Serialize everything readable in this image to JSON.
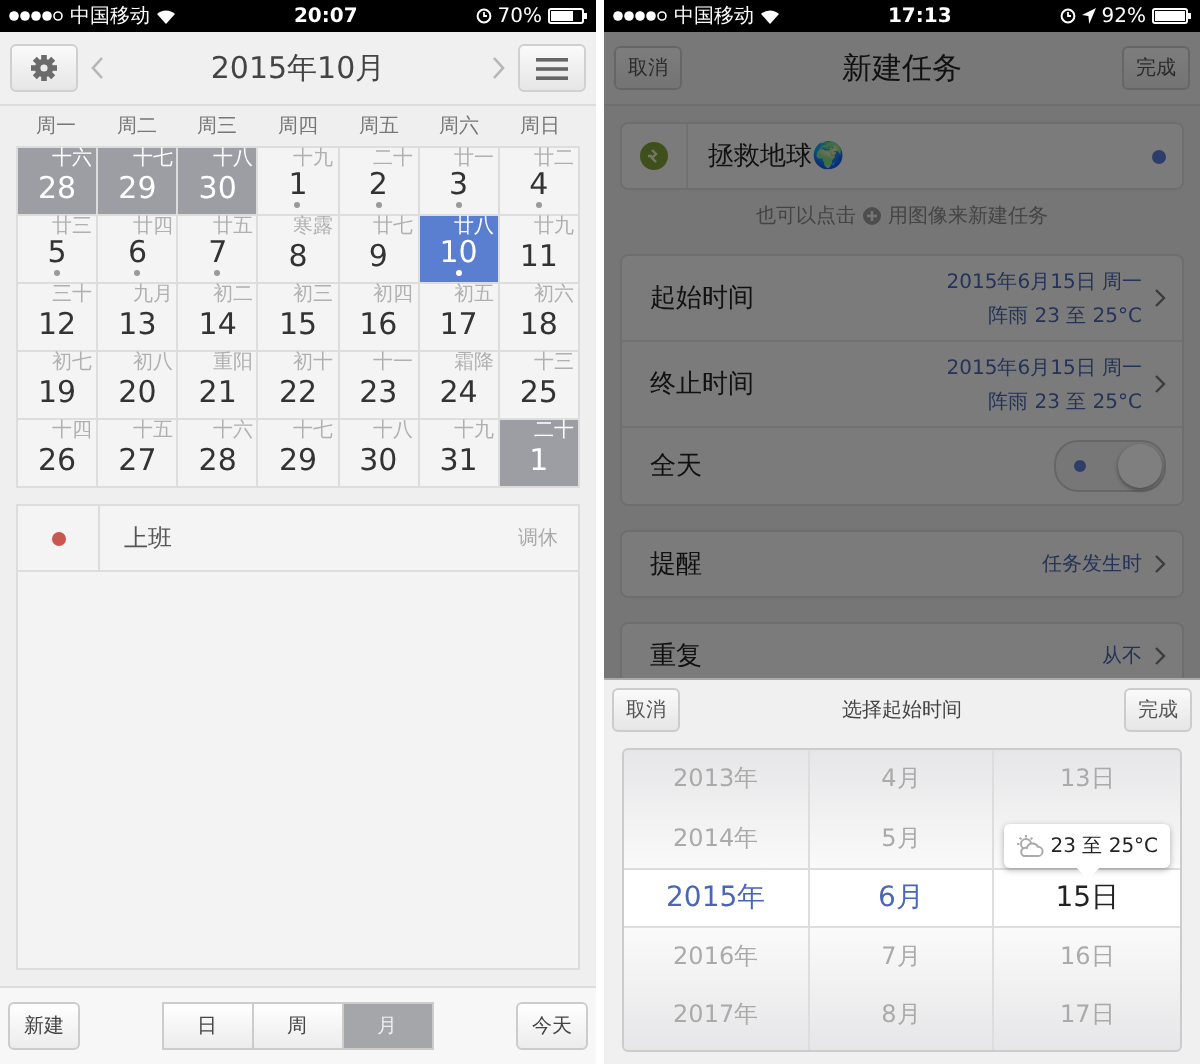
{
  "left": {
    "status_bar": {
      "carrier": "中国移动",
      "time": "20:07",
      "battery": "70%"
    },
    "nav": {
      "title": "2015年10月"
    },
    "weekdays": [
      "周一",
      "周二",
      "周三",
      "周四",
      "周五",
      "周六",
      "周日"
    ],
    "days": [
      {
        "day": "28",
        "lunar": "十六",
        "muted": true,
        "selected": false,
        "event": false
      },
      {
        "day": "29",
        "lunar": "十七",
        "muted": true,
        "selected": false,
        "event": false
      },
      {
        "day": "30",
        "lunar": "十八",
        "muted": true,
        "selected": false,
        "event": false
      },
      {
        "day": "1",
        "lunar": "十九",
        "muted": false,
        "selected": false,
        "event": true
      },
      {
        "day": "2",
        "lunar": "二十",
        "muted": false,
        "selected": false,
        "event": true
      },
      {
        "day": "3",
        "lunar": "廿一",
        "muted": false,
        "selected": false,
        "event": true
      },
      {
        "day": "4",
        "lunar": "廿二",
        "muted": false,
        "selected": false,
        "event": true
      },
      {
        "day": "5",
        "lunar": "廿三",
        "muted": false,
        "selected": false,
        "event": true
      },
      {
        "day": "6",
        "lunar": "廿四",
        "muted": false,
        "selected": false,
        "event": true
      },
      {
        "day": "7",
        "lunar": "廿五",
        "muted": false,
        "selected": false,
        "event": true
      },
      {
        "day": "8",
        "lunar": "寒露",
        "muted": false,
        "selected": false,
        "event": false
      },
      {
        "day": "9",
        "lunar": "廿七",
        "muted": false,
        "selected": false,
        "event": false
      },
      {
        "day": "10",
        "lunar": "廿八",
        "muted": false,
        "selected": true,
        "event": true
      },
      {
        "day": "11",
        "lunar": "廿九",
        "muted": false,
        "selected": false,
        "event": false
      },
      {
        "day": "12",
        "lunar": "三十",
        "muted": false,
        "selected": false,
        "event": false
      },
      {
        "day": "13",
        "lunar": "九月",
        "muted": false,
        "selected": false,
        "event": false
      },
      {
        "day": "14",
        "lunar": "初二",
        "muted": false,
        "selected": false,
        "event": false
      },
      {
        "day": "15",
        "lunar": "初三",
        "muted": false,
        "selected": false,
        "event": false
      },
      {
        "day": "16",
        "lunar": "初四",
        "muted": false,
        "selected": false,
        "event": false
      },
      {
        "day": "17",
        "lunar": "初五",
        "muted": false,
        "selected": false,
        "event": false
      },
      {
        "day": "18",
        "lunar": "初六",
        "muted": false,
        "selected": false,
        "event": false
      },
      {
        "day": "19",
        "lunar": "初七",
        "muted": false,
        "selected": false,
        "event": false
      },
      {
        "day": "20",
        "lunar": "初八",
        "muted": false,
        "selected": false,
        "event": false
      },
      {
        "day": "21",
        "lunar": "重阳",
        "muted": false,
        "selected": false,
        "event": false
      },
      {
        "day": "22",
        "lunar": "初十",
        "muted": false,
        "selected": false,
        "event": false
      },
      {
        "day": "23",
        "lunar": "十一",
        "muted": false,
        "selected": false,
        "event": false
      },
      {
        "day": "24",
        "lunar": "霜降",
        "muted": false,
        "selected": false,
        "event": false
      },
      {
        "day": "25",
        "lunar": "十三",
        "muted": false,
        "selected": false,
        "event": false
      },
      {
        "day": "26",
        "lunar": "十四",
        "muted": false,
        "selected": false,
        "event": false
      },
      {
        "day": "27",
        "lunar": "十五",
        "muted": false,
        "selected": false,
        "event": false
      },
      {
        "day": "28",
        "lunar": "十六",
        "muted": false,
        "selected": false,
        "event": false
      },
      {
        "day": "29",
        "lunar": "十七",
        "muted": false,
        "selected": false,
        "event": false
      },
      {
        "day": "30",
        "lunar": "十八",
        "muted": false,
        "selected": false,
        "event": false
      },
      {
        "day": "31",
        "lunar": "十九",
        "muted": false,
        "selected": false,
        "event": false
      },
      {
        "day": "1",
        "lunar": "二十",
        "muted": true,
        "selected": false,
        "event": false
      }
    ],
    "events": [
      {
        "title": "上班",
        "tag": "调休",
        "color": "#c9574f"
      }
    ],
    "toolbar": {
      "new": "新建",
      "views": [
        {
          "label": "日",
          "selected": false
        },
        {
          "label": "周",
          "selected": false
        },
        {
          "label": "月",
          "selected": true
        }
      ],
      "today": "今天"
    }
  },
  "right": {
    "status_bar": {
      "carrier": "中国移动",
      "time": "17:13",
      "battery": "92%"
    },
    "nav": {
      "cancel": "取消",
      "title": "新建任务",
      "done": "完成"
    },
    "task": {
      "value": "拯救地球🌍"
    },
    "hint": {
      "before": "也可以点击",
      "after": "用图像来新建任务"
    },
    "times": [
      {
        "label": "起始时间",
        "date": "2015年6月15日 周一",
        "weather": "阵雨  23 至 25°C"
      },
      {
        "label": "终止时间",
        "date": "2015年6月15日 周一",
        "weather": "阵雨  23 至 25°C"
      }
    ],
    "all_day": {
      "label": "全天",
      "on": true
    },
    "rows": [
      {
        "label": "提醒",
        "value": "任务发生时"
      },
      {
        "label": "重复",
        "value": "从不"
      }
    ],
    "sheet": {
      "cancel": "取消",
      "title": "选择起始时间",
      "done": "完成",
      "columns": [
        {
          "items": [
            {
              "label": "2013年",
              "selected": false
            },
            {
              "label": "2014年",
              "selected": false
            },
            {
              "label": "2015年",
              "selected": true
            },
            {
              "label": "2016年",
              "selected": false
            },
            {
              "label": "2017年",
              "selected": false
            }
          ]
        },
        {
          "items": [
            {
              "label": "4月",
              "selected": false
            },
            {
              "label": "5月",
              "selected": false
            },
            {
              "label": "6月",
              "selected": true
            },
            {
              "label": "7月",
              "selected": false
            },
            {
              "label": "8月",
              "selected": false
            }
          ]
        },
        {
          "items": [
            {
              "label": "13日",
              "selected": false
            },
            {
              "kind": "tooltip",
              "label": "23 至 25°C"
            },
            {
              "label": "15日",
              "selected": true
            },
            {
              "label": "16日",
              "selected": false
            },
            {
              "label": "17日",
              "selected": false
            }
          ]
        }
      ]
    }
  }
}
